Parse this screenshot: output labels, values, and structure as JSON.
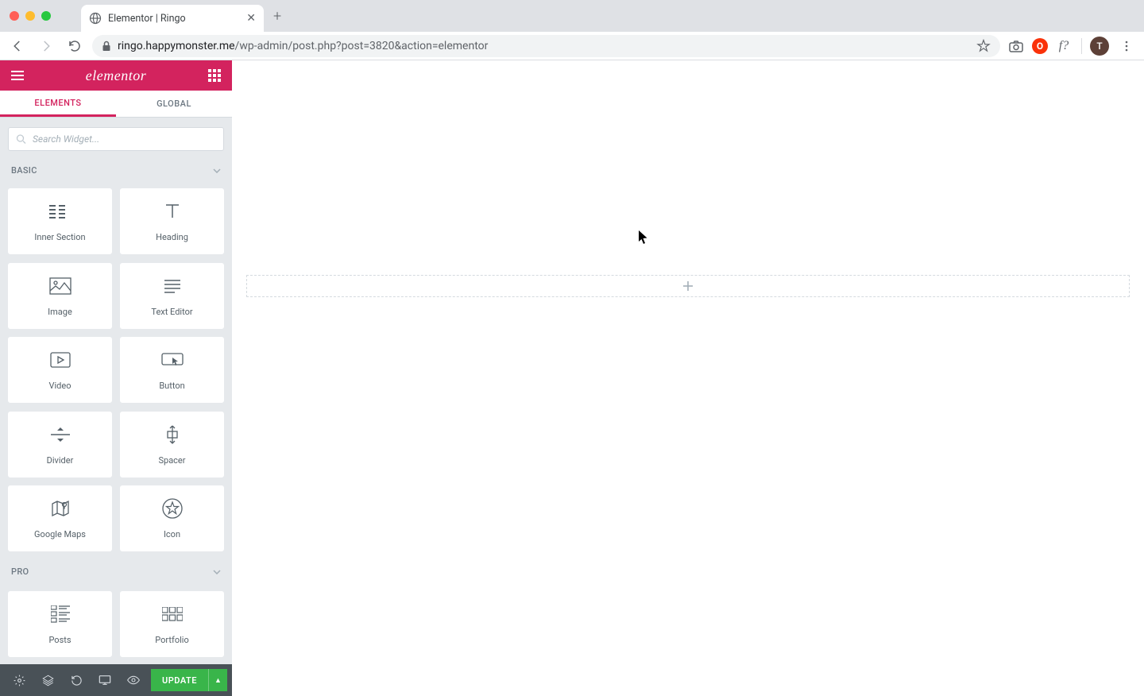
{
  "browser": {
    "tab_title": "Elementor | Ringo",
    "url_host": "ringo.happymonster.me",
    "url_path": "/wp-admin/post.php?post=3820&action=elementor",
    "avatar_letter": "T"
  },
  "sidebar": {
    "brand": "elementor",
    "tabs": {
      "elements": "ELEMENTS",
      "global": "GLOBAL"
    },
    "search_placeholder": "Search Widget...",
    "categories": {
      "basic": "BASIC",
      "pro": "PRO"
    },
    "widgets_basic": [
      {
        "label": "Inner Section",
        "icon": "inner-section"
      },
      {
        "label": "Heading",
        "icon": "heading"
      },
      {
        "label": "Image",
        "icon": "image"
      },
      {
        "label": "Text Editor",
        "icon": "text-editor"
      },
      {
        "label": "Video",
        "icon": "video"
      },
      {
        "label": "Button",
        "icon": "button"
      },
      {
        "label": "Divider",
        "icon": "divider"
      },
      {
        "label": "Spacer",
        "icon": "spacer"
      },
      {
        "label": "Google Maps",
        "icon": "google-maps"
      },
      {
        "label": "Icon",
        "icon": "icon"
      }
    ],
    "widgets_pro": [
      {
        "label": "Posts",
        "icon": "posts"
      },
      {
        "label": "Portfolio",
        "icon": "portfolio"
      }
    ],
    "update_label": "UPDATE"
  }
}
